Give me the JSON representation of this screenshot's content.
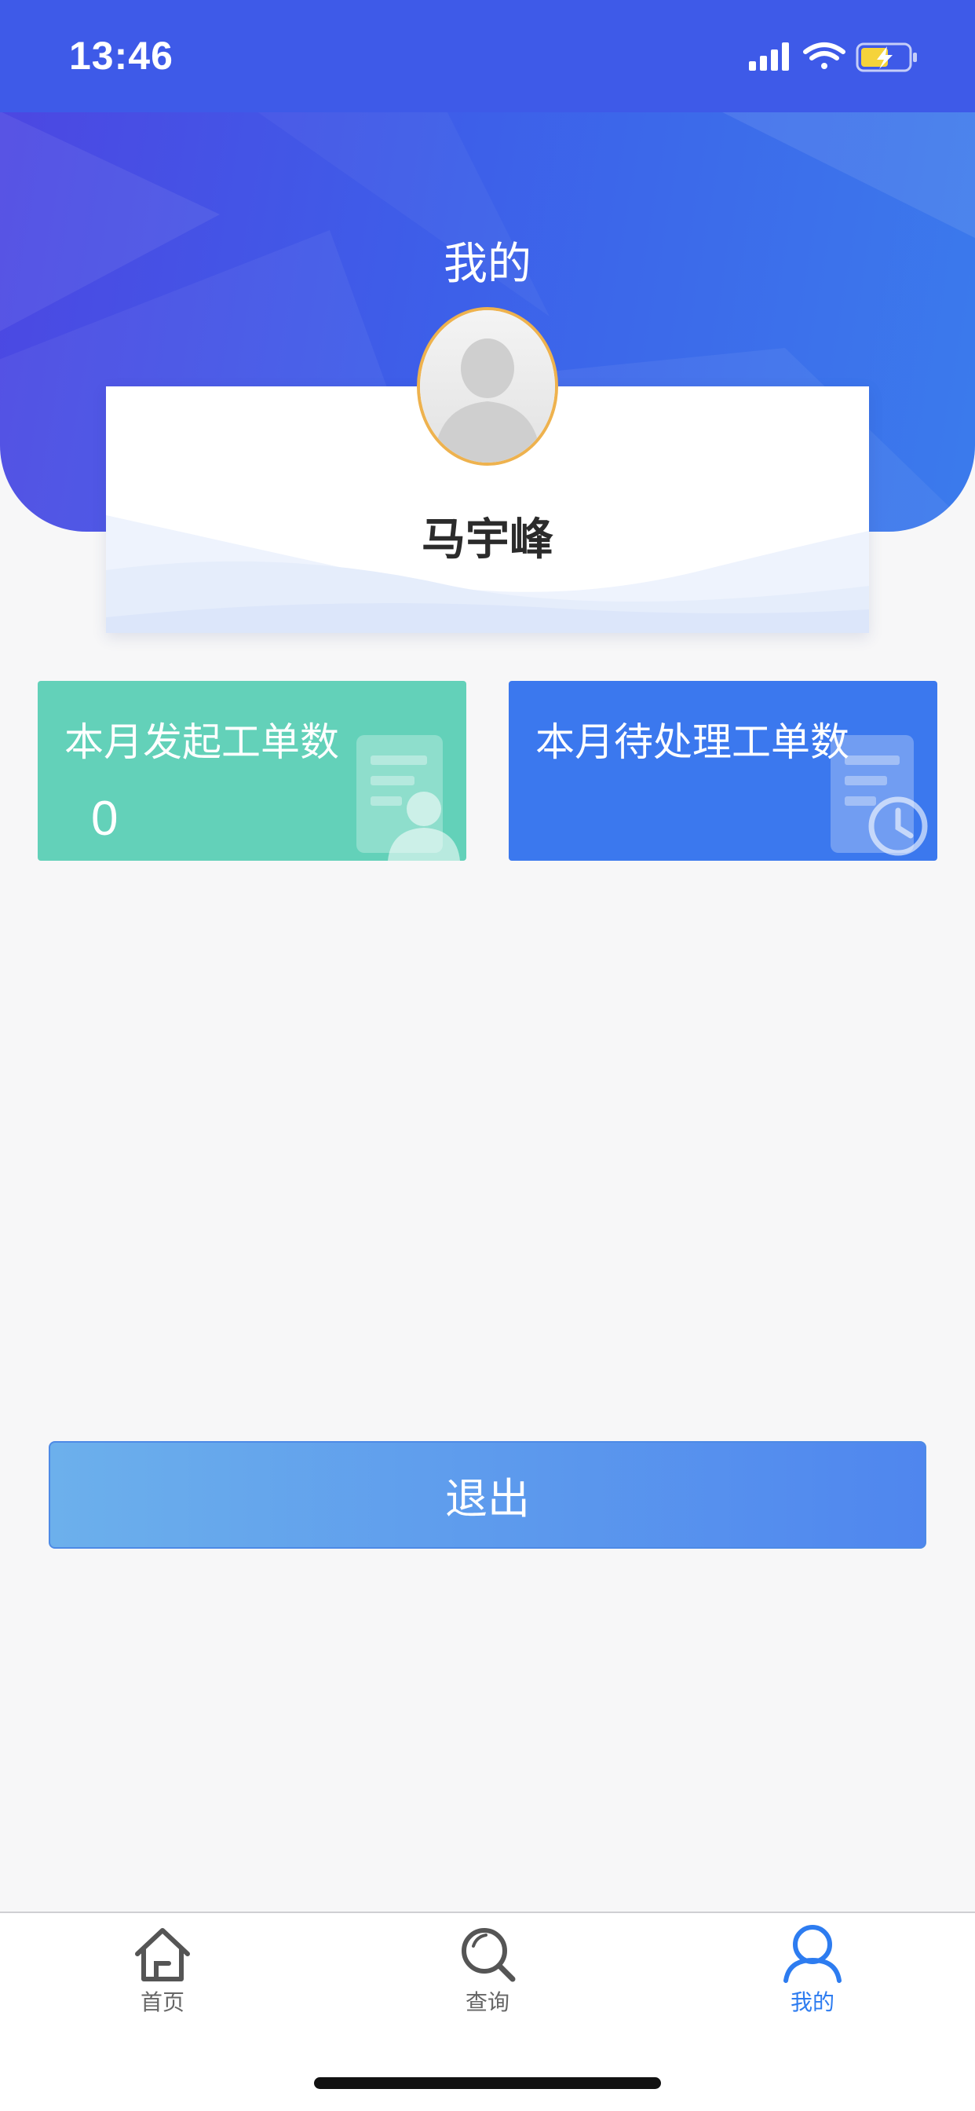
{
  "status_bar": {
    "time": "13:46",
    "icons": [
      "signal-icon",
      "wifi-icon",
      "battery-charging-icon"
    ]
  },
  "header": {
    "title": "我的"
  },
  "profile": {
    "name": "马宇峰",
    "avatar_icon": "user-avatar-icon"
  },
  "stats": [
    {
      "label": "本月发起工单数",
      "value": "0",
      "icon": "document-user-icon"
    },
    {
      "label": "本月待处理工单数",
      "value": "",
      "icon": "document-clock-icon"
    }
  ],
  "logout": {
    "label": "退出"
  },
  "tabs": [
    {
      "label": "首页",
      "icon": "home-icon",
      "active": false
    },
    {
      "label": "查询",
      "icon": "search-icon",
      "active": false
    },
    {
      "label": "我的",
      "icon": "user-icon",
      "active": true
    }
  ],
  "colors": {
    "header_gradient_start": "#4c47e2",
    "header_gradient_end": "#3b7bec",
    "stat_green": "#63d1b9",
    "stat_blue": "#3b78ee",
    "active_tab": "#2d7cf0",
    "avatar_ring": "#eeb24e"
  }
}
